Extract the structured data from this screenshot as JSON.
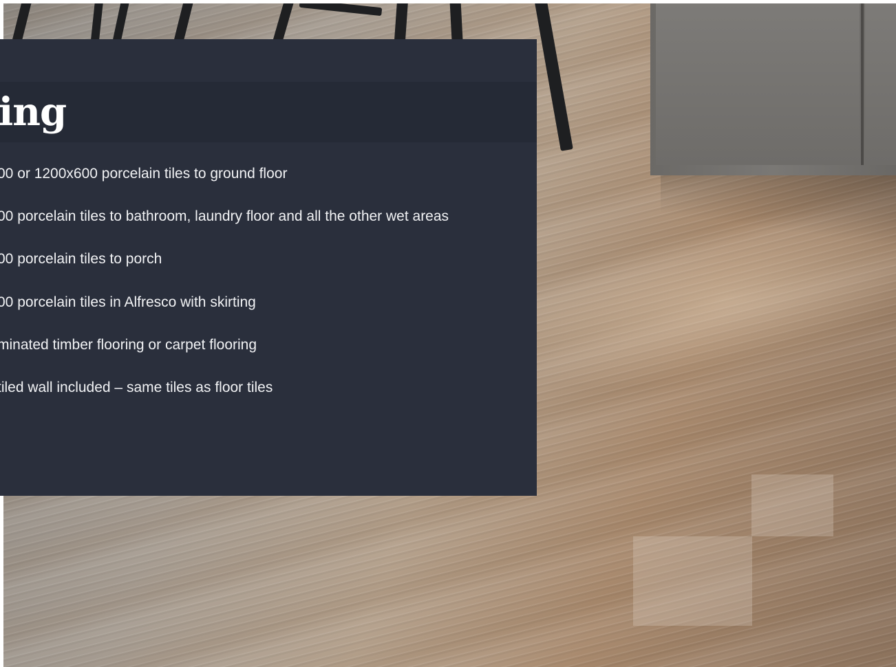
{
  "panel": {
    "title": "ing",
    "items": [
      "00 or 1200x600 porcelain tiles to ground floor",
      "00 porcelain tiles to bathroom, laundry floor and all the other wet areas",
      "00 porcelain tiles to porch",
      "00 porcelain tiles in Alfresco with skirting",
      "minated timber flooring or carpet flooring",
      " tiled wall included – same tiles as floor tiles"
    ]
  },
  "colors": {
    "panel_background": "#2a2f3c",
    "title_band_background": "#252a36",
    "text": "#ffffff"
  }
}
